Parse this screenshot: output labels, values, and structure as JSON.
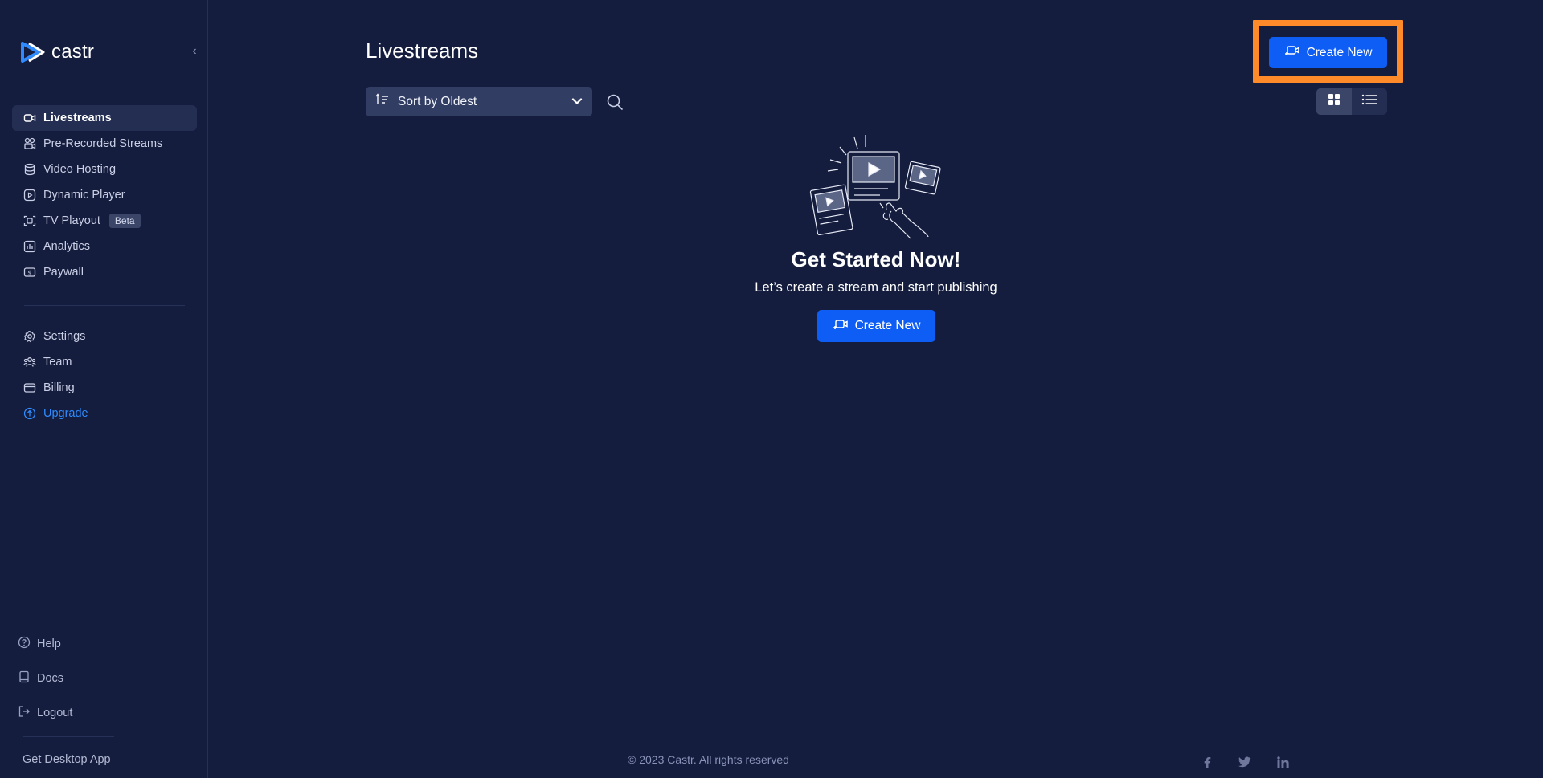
{
  "brand": {
    "name": "castr"
  },
  "sidebar": {
    "main_items": [
      {
        "label": "Livestreams",
        "icon": "video-camera-icon",
        "active": true
      },
      {
        "label": "Pre-Recorded Streams",
        "icon": "pre-recorded-icon"
      },
      {
        "label": "Video Hosting",
        "icon": "database-icon"
      },
      {
        "label": "Dynamic Player",
        "icon": "play-box-icon"
      },
      {
        "label": "TV Playout",
        "icon": "tv-playout-icon",
        "badge": "Beta"
      },
      {
        "label": "Analytics",
        "icon": "analytics-icon"
      },
      {
        "label": "Paywall",
        "icon": "paywall-icon"
      }
    ],
    "secondary_items": [
      {
        "label": "Settings",
        "icon": "gear-icon"
      },
      {
        "label": "Team",
        "icon": "team-icon"
      },
      {
        "label": "Billing",
        "icon": "card-icon"
      },
      {
        "label": "Upgrade",
        "icon": "upgrade-icon",
        "accent": "#2f8bff"
      }
    ],
    "bottom_items": [
      {
        "label": "Help",
        "icon": "help-icon"
      },
      {
        "label": "Docs",
        "icon": "book-icon"
      },
      {
        "label": "Logout",
        "icon": "logout-icon"
      }
    ],
    "desktop_app": "Get Desktop App"
  },
  "header": {
    "title": "Livestreams",
    "create_label": "Create New"
  },
  "toolbar": {
    "sort_label": "Sort by Oldest"
  },
  "empty_state": {
    "title": "Get Started Now!",
    "subtitle": "Let’s create a stream and start publishing",
    "button_label": "Create New"
  },
  "footer": {
    "copyright": "© 2023 Castr. All rights reserved",
    "social": [
      "facebook-icon",
      "twitter-icon",
      "linkedin-icon"
    ]
  },
  "colors": {
    "background": "#141d3d",
    "primary": "#0e5ef5",
    "highlight": "#ff8a2a",
    "accent": "#2f8bff"
  }
}
